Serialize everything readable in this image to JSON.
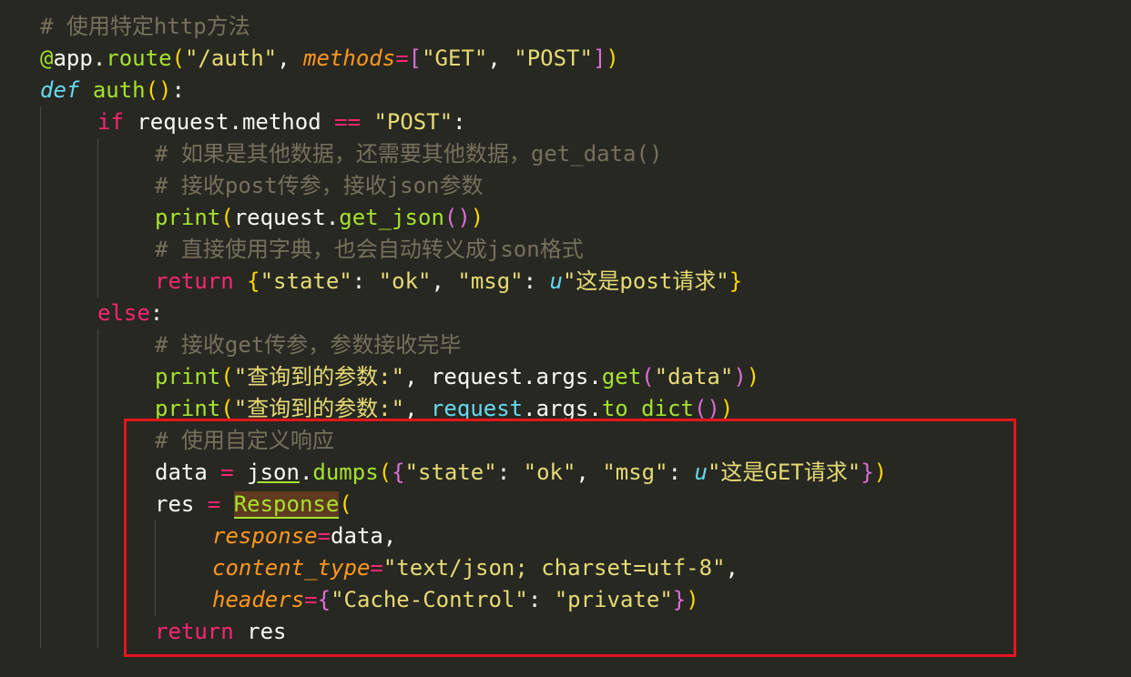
{
  "code_lines": [
    {
      "indent": 0,
      "tokens": [
        {
          "t": "# 使用特定http方法",
          "c": "comment"
        }
      ]
    },
    {
      "indent": 0,
      "tokens": [
        {
          "t": "@",
          "c": "dec"
        },
        {
          "t": "app",
          "c": "plain"
        },
        {
          "t": ".",
          "c": "plain"
        },
        {
          "t": "route",
          "c": "fn"
        },
        {
          "t": "(",
          "c": "b1"
        },
        {
          "t": "\"/auth\"",
          "c": "str"
        },
        {
          "t": ", ",
          "c": "plain"
        },
        {
          "t": "methods",
          "c": "param"
        },
        {
          "t": "=",
          "c": "op"
        },
        {
          "t": "[",
          "c": "b2"
        },
        {
          "t": "\"GET\"",
          "c": "str"
        },
        {
          "t": ", ",
          "c": "plain"
        },
        {
          "t": "\"POST\"",
          "c": "str"
        },
        {
          "t": "]",
          "c": "b2"
        },
        {
          "t": ")",
          "c": "b1"
        }
      ]
    },
    {
      "indent": 0,
      "tokens": [
        {
          "t": "def",
          "c": "italic-kw"
        },
        {
          "t": " ",
          "c": "plain"
        },
        {
          "t": "auth",
          "c": "fn"
        },
        {
          "t": "()",
          "c": "b1"
        },
        {
          "t": ":",
          "c": "plain"
        }
      ]
    },
    {
      "indent": 1,
      "tokens": [
        {
          "t": "if",
          "c": "kw"
        },
        {
          "t": " request.method ",
          "c": "plain"
        },
        {
          "t": "==",
          "c": "op"
        },
        {
          "t": " ",
          "c": "plain"
        },
        {
          "t": "\"POST\"",
          "c": "str"
        },
        {
          "t": ":",
          "c": "plain"
        }
      ]
    },
    {
      "indent": 2,
      "tokens": [
        {
          "t": "# 如果是其他数据，还需要其他数据，get_data()",
          "c": "comment"
        }
      ]
    },
    {
      "indent": 2,
      "tokens": [
        {
          "t": "# 接收post传参，接收json参数",
          "c": "comment"
        }
      ]
    },
    {
      "indent": 2,
      "tokens": [
        {
          "t": "print",
          "c": "fn"
        },
        {
          "t": "(",
          "c": "b1"
        },
        {
          "t": "request.",
          "c": "plain"
        },
        {
          "t": "get_json",
          "c": "fn"
        },
        {
          "t": "()",
          "c": "b2"
        },
        {
          "t": ")",
          "c": "b1"
        }
      ]
    },
    {
      "indent": 2,
      "tokens": [
        {
          "t": "# 直接使用字典，也会自动转义成json格式",
          "c": "comment"
        }
      ]
    },
    {
      "indent": 2,
      "tokens": [
        {
          "t": "return",
          "c": "kw"
        },
        {
          "t": " ",
          "c": "plain"
        },
        {
          "t": "{",
          "c": "b1"
        },
        {
          "t": "\"state\"",
          "c": "str"
        },
        {
          "t": ": ",
          "c": "plain"
        },
        {
          "t": "\"ok\"",
          "c": "str"
        },
        {
          "t": ", ",
          "c": "plain"
        },
        {
          "t": "\"msg\"",
          "c": "str"
        },
        {
          "t": ": ",
          "c": "plain"
        },
        {
          "t": "u",
          "c": "italic-kw"
        },
        {
          "t": "\"这是post请求\"",
          "c": "str"
        },
        {
          "t": "}",
          "c": "b1"
        }
      ]
    },
    {
      "indent": 1,
      "tokens": [
        {
          "t": "else",
          "c": "kw"
        },
        {
          "t": ":",
          "c": "plain"
        }
      ]
    },
    {
      "indent": 2,
      "tokens": [
        {
          "t": "# 接收get传参，参数接收完毕",
          "c": "comment"
        }
      ]
    },
    {
      "indent": 2,
      "tokens": [
        {
          "t": "print",
          "c": "fn"
        },
        {
          "t": "(",
          "c": "b1"
        },
        {
          "t": "\"查询到的参数:\"",
          "c": "str"
        },
        {
          "t": ", request.args.",
          "c": "plain"
        },
        {
          "t": "get",
          "c": "fn"
        },
        {
          "t": "(",
          "c": "b2"
        },
        {
          "t": "\"data\"",
          "c": "str"
        },
        {
          "t": ")",
          "c": "b2"
        },
        {
          "t": ")",
          "c": "b1"
        }
      ]
    },
    {
      "indent": 2,
      "tokens": [
        {
          "t": "print",
          "c": "fn"
        },
        {
          "t": "(",
          "c": "b1"
        },
        {
          "t": "\"查询到的参数:\"",
          "c": "str"
        },
        {
          "t": ", ",
          "c": "plain"
        },
        {
          "t": "request",
          "c": "blue"
        },
        {
          "t": ".args.",
          "c": "plain"
        },
        {
          "t": "to_dict",
          "c": "fn"
        },
        {
          "t": "()",
          "c": "b2"
        },
        {
          "t": ")",
          "c": "b1"
        }
      ]
    },
    {
      "indent": 2,
      "tokens": [
        {
          "t": "# 使用自定义响应",
          "c": "comment"
        }
      ]
    },
    {
      "indent": 2,
      "tokens": [
        {
          "t": "data ",
          "c": "plain"
        },
        {
          "t": "=",
          "c": "op"
        },
        {
          "t": " ",
          "c": "plain"
        },
        {
          "t": "json",
          "c": "under"
        },
        {
          "t": ".",
          "c": "plain"
        },
        {
          "t": "dumps",
          "c": "fn"
        },
        {
          "t": "(",
          "c": "b1"
        },
        {
          "t": "{",
          "c": "b2"
        },
        {
          "t": "\"state\"",
          "c": "str"
        },
        {
          "t": ": ",
          "c": "plain"
        },
        {
          "t": "\"ok\"",
          "c": "str"
        },
        {
          "t": ", ",
          "c": "plain"
        },
        {
          "t": "\"msg\"",
          "c": "str"
        },
        {
          "t": ": ",
          "c": "plain"
        },
        {
          "t": "u",
          "c": "italic-kw"
        },
        {
          "t": "\"这是GET请求\"",
          "c": "str"
        },
        {
          "t": "}",
          "c": "b2"
        },
        {
          "t": ")",
          "c": "b1"
        }
      ]
    },
    {
      "indent": 2,
      "tokens": [
        {
          "t": "res ",
          "c": "plain"
        },
        {
          "t": "=",
          "c": "op"
        },
        {
          "t": " ",
          "c": "plain"
        },
        {
          "t": "Response",
          "c": "sel"
        },
        {
          "t": "(",
          "c": "b1"
        }
      ]
    },
    {
      "indent": 3,
      "tokens": [
        {
          "t": "response",
          "c": "param"
        },
        {
          "t": "=",
          "c": "op"
        },
        {
          "t": "data,",
          "c": "plain"
        }
      ]
    },
    {
      "indent": 3,
      "tokens": [
        {
          "t": "content_type",
          "c": "param"
        },
        {
          "t": "=",
          "c": "op"
        },
        {
          "t": "\"text/json; charset=utf-8\"",
          "c": "str"
        },
        {
          "t": ",",
          "c": "plain"
        }
      ]
    },
    {
      "indent": 3,
      "tokens": [
        {
          "t": "headers",
          "c": "param"
        },
        {
          "t": "=",
          "c": "op"
        },
        {
          "t": "{",
          "c": "b2"
        },
        {
          "t": "\"Cache-Control\"",
          "c": "str"
        },
        {
          "t": ": ",
          "c": "plain"
        },
        {
          "t": "\"private\"",
          "c": "str"
        },
        {
          "t": "}",
          "c": "b2"
        },
        {
          "t": ")",
          "c": "b1"
        }
      ]
    },
    {
      "indent": 2,
      "tokens": [
        {
          "t": "return",
          "c": "kw"
        },
        {
          "t": " res",
          "c": "plain"
        }
      ]
    }
  ]
}
